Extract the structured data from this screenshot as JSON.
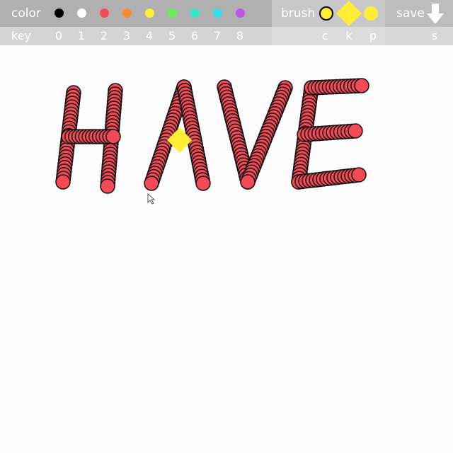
{
  "toolbar": {
    "color_label": "color",
    "key_label": "key",
    "brush_label": "brush",
    "save_label": "save",
    "palette": [
      {
        "key": "0",
        "color": "#000000"
      },
      {
        "key": "1",
        "color": "#ffffff"
      },
      {
        "key": "2",
        "color": "#f44a55"
      },
      {
        "key": "3",
        "color": "#ff8833"
      },
      {
        "key": "4",
        "color": "#ffee33"
      },
      {
        "key": "5",
        "color": "#66ee55"
      },
      {
        "key": "6",
        "color": "#33e8c8"
      },
      {
        "key": "7",
        "color": "#33ddee"
      },
      {
        "key": "8",
        "color": "#bb55ee"
      }
    ],
    "brushes": [
      {
        "name": "circle-brush",
        "key": "c"
      },
      {
        "name": "diamond-brush",
        "key": "k"
      },
      {
        "name": "dot-brush",
        "key": "p"
      }
    ],
    "save_key": "s",
    "brush_color": "#ffee33",
    "stroke_color": "#f44a55"
  },
  "canvas": {
    "drawn_text": "HAVE",
    "cursor_icon": "arrow-cursor-icon"
  }
}
